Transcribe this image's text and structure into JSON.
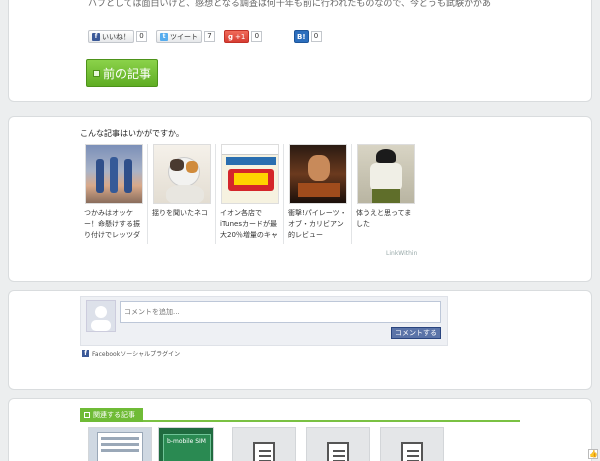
{
  "top_text": "ハブとしては面白いけど、感想となる調査は何十年も前に行われたものなので、今どうも試験かがあ",
  "social": {
    "like_label": "いいね！",
    "like_count": "0",
    "tweet_label": "ツイート",
    "tweet_count": "7",
    "gplus_label": "+1",
    "gplus_count": "0",
    "hatena_label": "B!",
    "hatena_count": "0"
  },
  "prev_button": "前の記事",
  "recommend": {
    "title": "こんな記事はいかがですか。",
    "items": [
      {
        "caption": "つかみはオッケー！命懸けする振り付けでレッツダンス！"
      },
      {
        "caption": "揺りを聞いたネコ"
      },
      {
        "caption": "イオン各店でiTunesカードが最大20％増量のキャンペーン中"
      },
      {
        "caption": "衝撃!パイレーツ・オブ・カリビアン的レビュー"
      },
      {
        "caption": "体うえと思ってました"
      }
    ],
    "linkwithin": "LinkWithin"
  },
  "comments": {
    "placeholder": "コメントを追加...",
    "submit": "コメントする",
    "plugin": "Facebookソーシャルプラグイン"
  },
  "related": {
    "header": "関連する記事",
    "items": [
      "",
      "b-mobile SIM",
      "",
      "",
      ""
    ]
  },
  "colors": {
    "accent_green": "#6fbb36",
    "facebook_blue": "#3b5998",
    "button_blue": "#5b74a8"
  }
}
